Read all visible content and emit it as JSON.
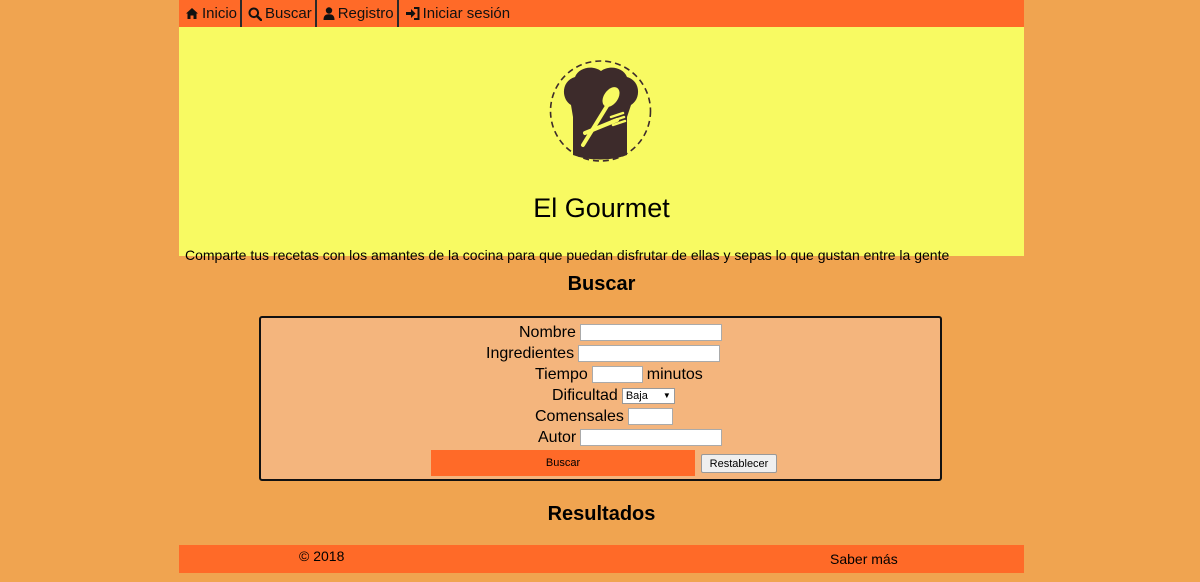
{
  "nav": {
    "items": [
      {
        "label": "Inicio",
        "icon": "home-icon"
      },
      {
        "label": "Buscar",
        "icon": "search-icon"
      },
      {
        "label": "Registro",
        "icon": "user-icon"
      },
      {
        "label": "Iniciar sesión",
        "icon": "sign-in-icon"
      }
    ]
  },
  "header": {
    "title": "El Gourmet",
    "tagline": "Comparte tus recetas con los amantes de la cocina para que puedan disfrutar de ellas y sepas lo que gustan entre la gente",
    "logo_icon": "chef-hat-logo-icon"
  },
  "search": {
    "title": "Buscar",
    "fields": {
      "nombre_label": "Nombre",
      "nombre_value": "",
      "ingredientes_label": "Ingredientes",
      "ingredientes_value": "",
      "tiempo_label": "Tiempo",
      "tiempo_value": "",
      "tiempo_unit": "minutos",
      "dificultad_label": "Dificultad",
      "dificultad_value": "Baja",
      "comensales_label": "Comensales",
      "comensales_value": "",
      "autor_label": "Autor",
      "autor_value": ""
    },
    "submit_label": "Buscar",
    "reset_label": "Restablecer"
  },
  "results": {
    "title": "Resultados"
  },
  "footer": {
    "copyright": "© 2018",
    "more_link": "Saber más"
  },
  "colors": {
    "page_bg": "#f0a450",
    "nav_bg": "#ff6a28",
    "header_bg": "#f8fa62",
    "form_bg": "#f4b57d",
    "logo_dark": "#3d2b2b"
  }
}
